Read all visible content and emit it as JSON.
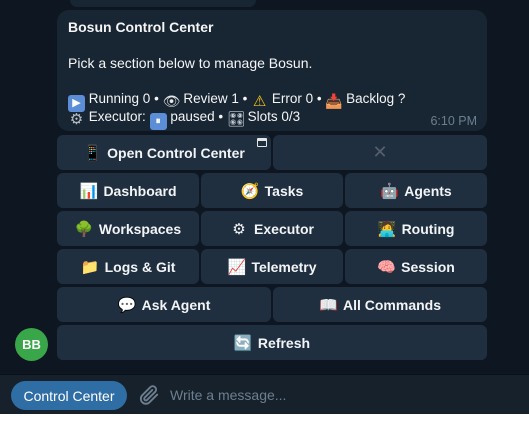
{
  "message": {
    "title": "Bosun Control Center",
    "body": "Pick a section below to manage Bosun.",
    "status_line1": [
      {
        "icon": "play-icon",
        "glyph": "▶",
        "text": "Running 0 •"
      },
      {
        "icon": "eye-icon",
        "glyph": "👁",
        "text": "Review 1 •"
      },
      {
        "icon": "warning-icon",
        "glyph": "⚠",
        "text": "Error 0 •"
      },
      {
        "icon": "inbox-tray-icon",
        "glyph": "📥",
        "text": "Backlog ?"
      }
    ],
    "status_line2": [
      {
        "icon": "gear-icon",
        "glyph": "⚙",
        "text": "Executor:"
      },
      {
        "icon": "pause-icon",
        "glyph": "⏸",
        "text": "paused •"
      },
      {
        "icon": "slots-icon",
        "glyph": "🎛",
        "text": "Slots 0/3"
      }
    ],
    "time": "6:10 PM"
  },
  "keyboard": {
    "row1": {
      "open": {
        "icon": "mobile-phone-icon",
        "glyph": "📱",
        "label": "Open Control Center"
      },
      "close": {
        "glyph": "✕"
      }
    },
    "row2": [
      {
        "name": "dashboard",
        "icon": "bar-chart-icon",
        "glyph": "📊",
        "label": "Dashboard"
      },
      {
        "name": "tasks",
        "icon": "compass-icon",
        "glyph": "🧭",
        "label": "Tasks"
      },
      {
        "name": "agents",
        "icon": "robot-icon",
        "glyph": "🤖",
        "label": "Agents"
      }
    ],
    "row3": [
      {
        "name": "workspaces",
        "icon": "tree-icon",
        "glyph": "🌳",
        "label": "Workspaces"
      },
      {
        "name": "executor",
        "icon": "gear-icon",
        "glyph": "⚙",
        "label": "Executor"
      },
      {
        "name": "routing",
        "icon": "person-routing-icon",
        "glyph": "🧑‍💻",
        "label": "Routing"
      }
    ],
    "row4": [
      {
        "name": "logs-git",
        "icon": "folder-icon",
        "glyph": "📁",
        "label": "Logs & Git"
      },
      {
        "name": "telemetry",
        "icon": "chart-increasing-icon",
        "glyph": "📈",
        "label": "Telemetry"
      },
      {
        "name": "session",
        "icon": "brain-icon",
        "glyph": "🧠",
        "label": "Session"
      }
    ],
    "row5": [
      {
        "name": "ask-agent",
        "icon": "speech-bubble-icon",
        "glyph": "💬",
        "label": "Ask Agent"
      },
      {
        "name": "all-commands",
        "icon": "open-book-icon",
        "glyph": "📖",
        "label": "All Commands"
      }
    ],
    "row6": {
      "name": "refresh",
      "icon": "refresh-icon",
      "glyph": "🔄",
      "label": "Refresh"
    }
  },
  "avatar": {
    "initials": "BB",
    "color": "#3aa64a"
  },
  "composer": {
    "menu_label": "Control Center",
    "placeholder": "Write a message..."
  },
  "colors": {
    "accent": "#2f6ea5",
    "background": "#0e1621",
    "bubble": "#182533",
    "button": "#1f2f3f"
  }
}
